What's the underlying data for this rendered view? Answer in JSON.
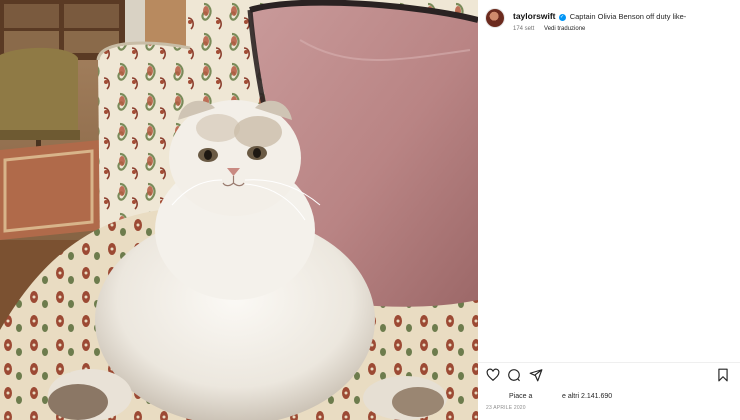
{
  "post": {
    "username": "taylorswift",
    "caption": "Captain Olivia Benson off duty like-",
    "time_ago": "174 sett",
    "translate_label": "Vedi traduzione",
    "likes_prefix": "Piace a",
    "likes_count": "e altri 2.141.690",
    "date": "23 APRILE 2020"
  },
  "icons": {
    "verified": "verified-badge-icon",
    "like": "heart-icon",
    "comment": "comment-icon",
    "share": "paper-plane-icon",
    "save": "bookmark-icon"
  },
  "colors": {
    "verified": "#0095f6",
    "text": "#262626",
    "muted": "#737373"
  }
}
